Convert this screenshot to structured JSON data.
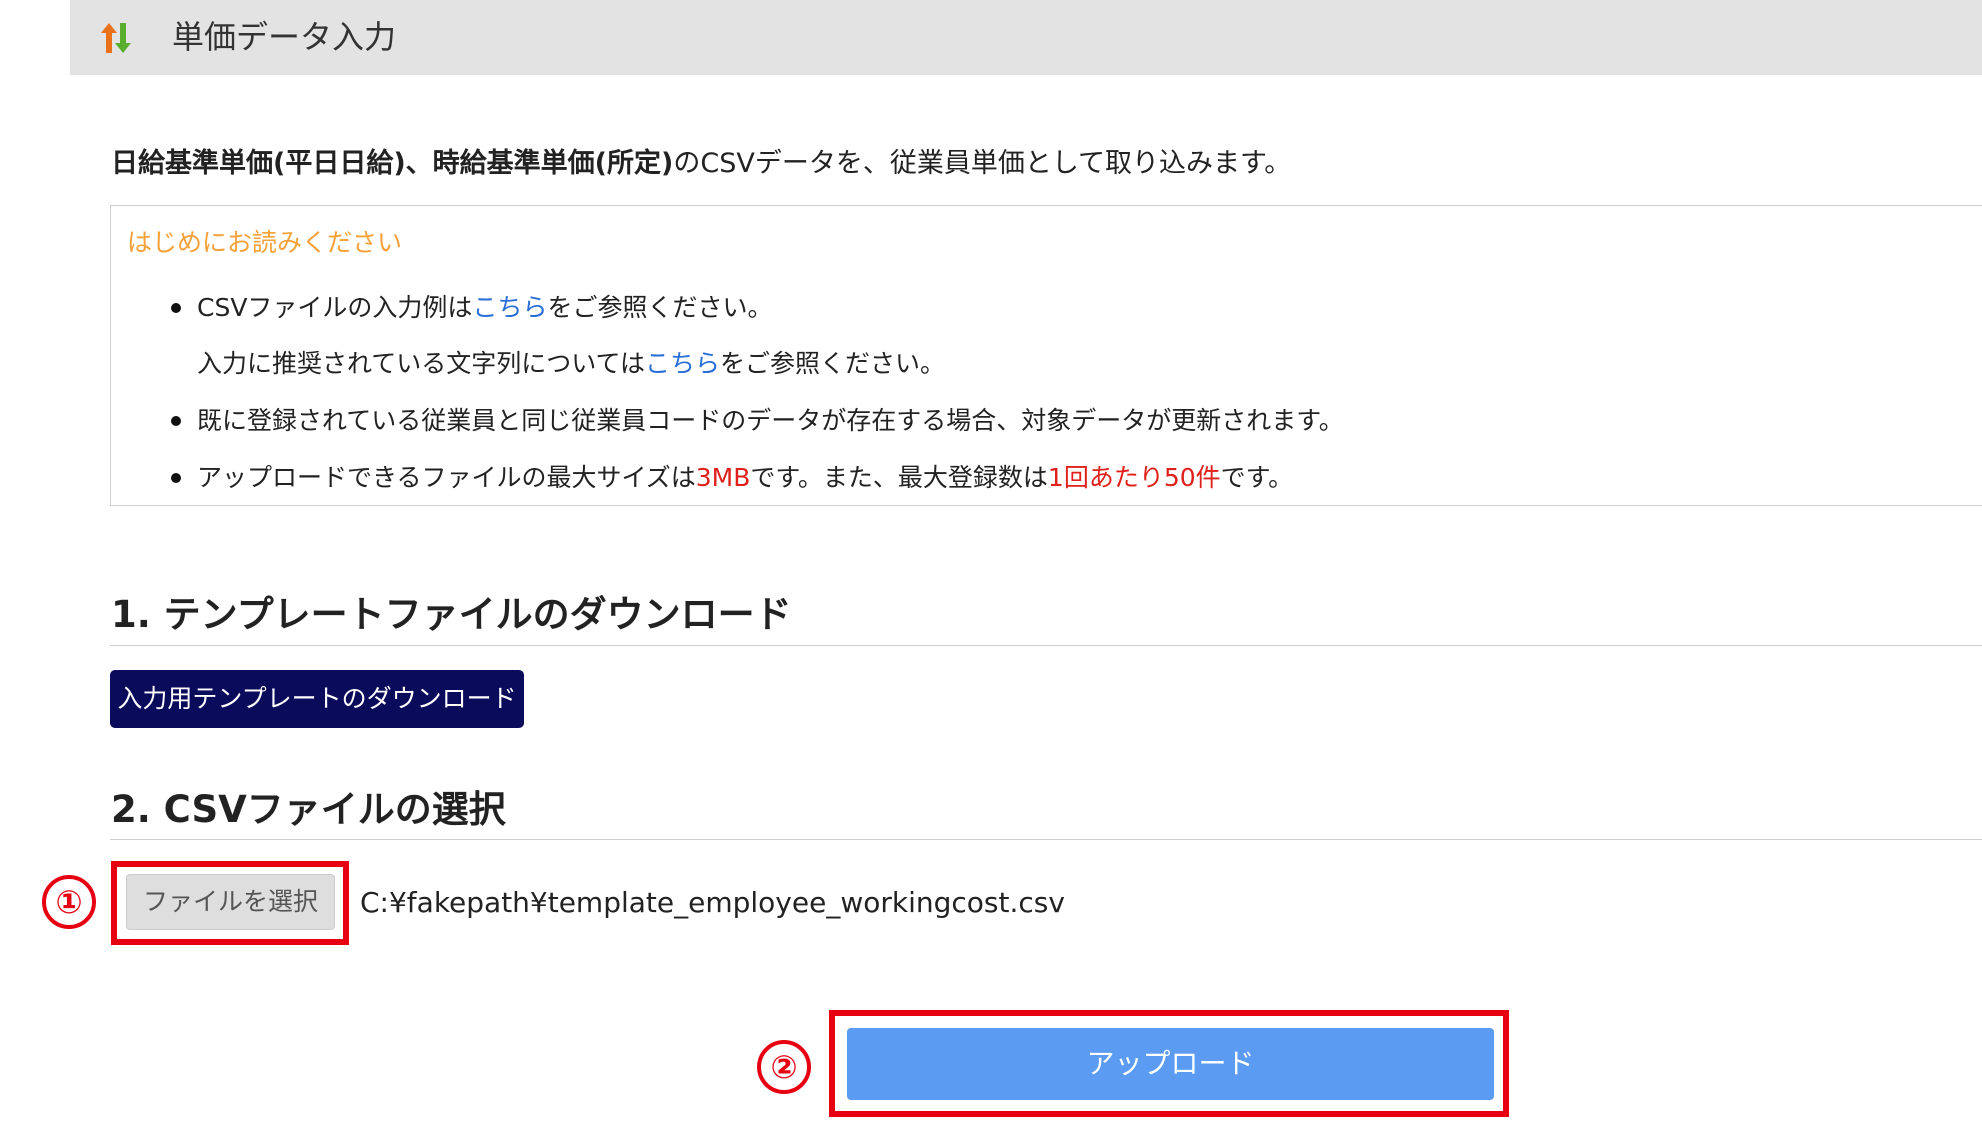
{
  "header": {
    "title": "単価データ入力",
    "icon": "sort-arrows-icon",
    "colors": {
      "up_arrow": "#e8711a",
      "down_arrow": "#5aae2e"
    }
  },
  "intro": {
    "bold_part": "日給基準単価(平日日給)、時給基準単価(所定)",
    "rest": "のCSVデータを、従業員単価として取り込みます。"
  },
  "notice": {
    "heading": "はじめにお読みください",
    "items": [
      {
        "pre": "CSVファイルの入力例は",
        "link": "こちら",
        "post": "をご参照ください。"
      },
      {
        "pre": "入力に推奨されている文字列については",
        "link": "こちら",
        "post": "をご参照ください。"
      },
      {
        "text": "既に登録されている従業員と同じ従業員コードのデータが存在する場合、対象データが更新されます。"
      },
      {
        "pre": "アップロードできるファイルの最大サイズは",
        "size": "3MB",
        "mid": "です。また、最大登録数は",
        "limit": "1回あたり50件",
        "post": "です。"
      }
    ]
  },
  "section1": {
    "title": "1. テンプレートファイルのダウンロード",
    "button_label": "入力用テンプレートのダウンロード"
  },
  "section2": {
    "title": "2. CSVファイルの選択",
    "file_button_label": "ファイルを選択",
    "file_path": "C:¥fakepath¥template_employee_workingcost.csv"
  },
  "upload": {
    "button_label": "アップロード"
  },
  "annotations": {
    "step1": "①",
    "step2": "②",
    "color": "#e60012"
  },
  "colors": {
    "accent_orange": "#f5a13a",
    "link_blue": "#2a6fd6",
    "warning_red": "#e0201b",
    "navy_button": "#0b0b5c",
    "upload_button": "#5b9cf2"
  }
}
